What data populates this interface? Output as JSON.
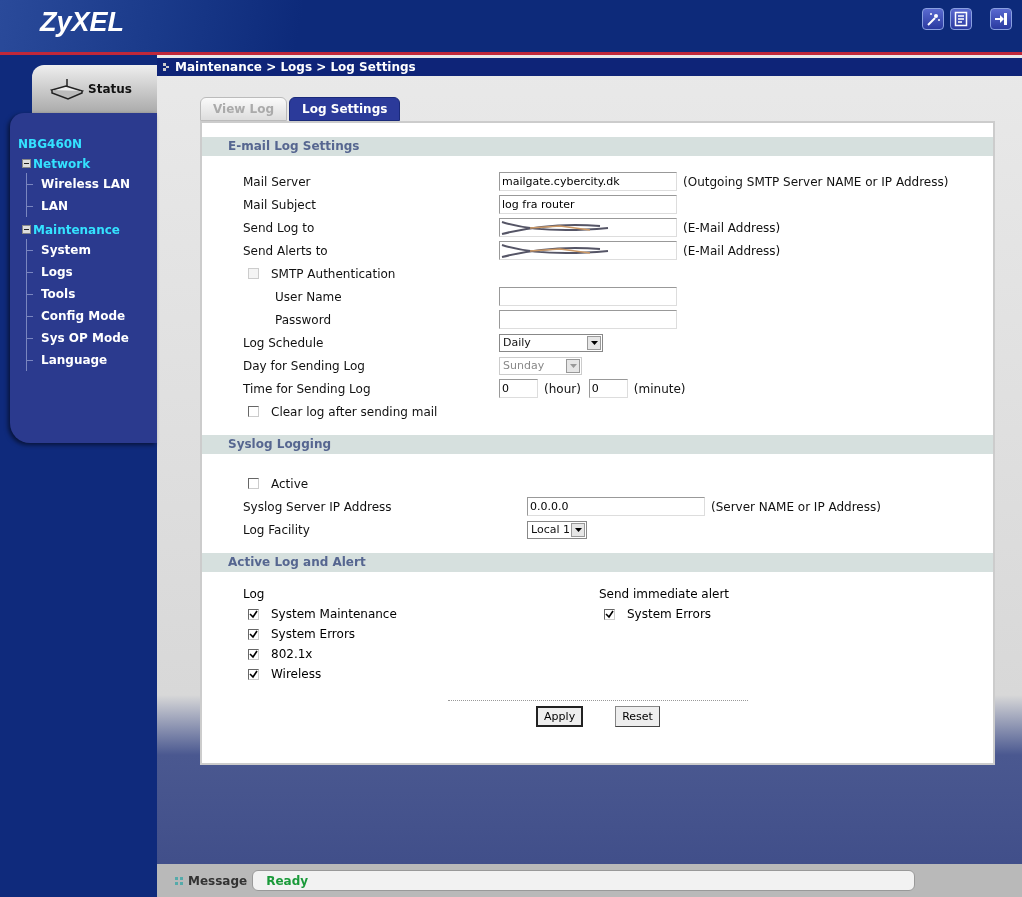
{
  "logo": "ZyXEL",
  "breadcrumb": "Maintenance > Logs > Log Settings",
  "sidebar": {
    "status_tab": "Status",
    "device": "NBG460N",
    "tree": [
      {
        "label": "Network",
        "expanded": true,
        "children": [
          {
            "label": "Wireless LAN"
          },
          {
            "label": "LAN"
          }
        ]
      },
      {
        "label": "Maintenance",
        "expanded": true,
        "children": [
          {
            "label": "System"
          },
          {
            "label": "Logs"
          },
          {
            "label": "Tools"
          },
          {
            "label": "Config Mode"
          },
          {
            "label": "Sys OP Mode"
          },
          {
            "label": "Language"
          }
        ]
      }
    ]
  },
  "tabs": [
    {
      "label": "View Log",
      "selected": false
    },
    {
      "label": "Log Settings",
      "selected": true
    }
  ],
  "sections": [
    {
      "title": "E-mail Log Settings",
      "rows": [
        {
          "kind": "text",
          "label": "Mail Server",
          "value": "mailgate.cybercity.dk",
          "note": "(Outgoing SMTP Server NAME or IP Address)"
        },
        {
          "kind": "text",
          "label": "Mail Subject",
          "value": "log fra router"
        },
        {
          "kind": "redacted",
          "label": "Send Log to",
          "note": "(E-Mail Address)"
        },
        {
          "kind": "redacted",
          "label": "Send Alerts to",
          "note": "(E-Mail Address)"
        },
        {
          "kind": "checkbox",
          "label": "SMTP Authentication",
          "checked": false,
          "disabled": true
        },
        {
          "kind": "text",
          "label": "User Name",
          "indented": true
        },
        {
          "kind": "text",
          "label": "Password",
          "indented": true
        },
        {
          "kind": "select",
          "label": "Log Schedule",
          "value": "Daily",
          "disabled": false
        },
        {
          "kind": "select",
          "label": "Day for Sending Log",
          "value": "Sunday",
          "disabled": true
        },
        {
          "kind": "time",
          "label": "Time for Sending Log",
          "hour": "0",
          "hour_unit": "(hour)",
          "minute": "0",
          "minute_unit": "(minute)"
        },
        {
          "kind": "checkbox",
          "label": "Clear log after sending mail",
          "checked": false,
          "disabled": false
        }
      ]
    },
    {
      "title": "Syslog Logging",
      "rows": [
        {
          "kind": "checkbox",
          "label": "Active",
          "checked": false,
          "disabled": false
        },
        {
          "kind": "text",
          "label": "Syslog Server IP Address",
          "value": "0.0.0.0",
          "note": "(Server NAME or IP Address)"
        },
        {
          "kind": "select",
          "label": "Log Facility",
          "value": "Local 1",
          "disabled": false
        }
      ]
    }
  ],
  "alerts": {
    "title": "Active Log and Alert",
    "log_title": "Log",
    "log_items": [
      {
        "label": "System Maintenance",
        "checked": true
      },
      {
        "label": "System Errors",
        "checked": true
      },
      {
        "label": "802.1x",
        "checked": true
      },
      {
        "label": "Wireless",
        "checked": true
      }
    ],
    "alert_title": "Send immediate alert",
    "alert_items": [
      {
        "label": "System Errors",
        "checked": true
      }
    ]
  },
  "buttons": [
    "Apply",
    "Reset"
  ],
  "status_bar": {
    "label": "Message",
    "text": "Ready"
  }
}
